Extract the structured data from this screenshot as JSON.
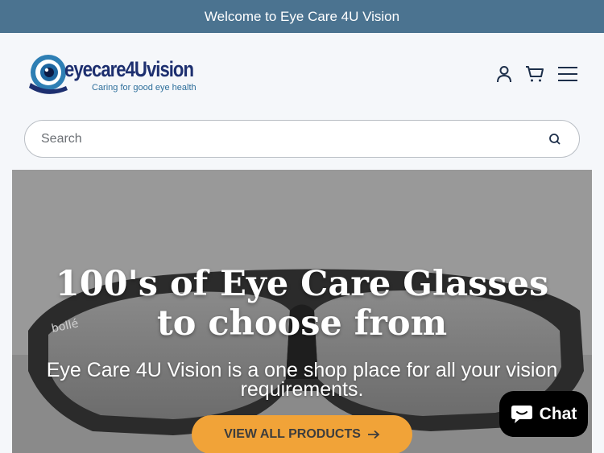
{
  "announcement": {
    "text": "Welcome to Eye Care 4U Vision"
  },
  "brand": {
    "wordmark": "eyecare4Uvision",
    "tagline": "Caring for good eye health"
  },
  "header_icons": [
    {
      "name": "account-icon"
    },
    {
      "name": "cart-icon"
    },
    {
      "name": "menu-icon"
    }
  ],
  "search": {
    "placeholder": "Search",
    "value": ""
  },
  "hero": {
    "title_line1": "100's of Eye Care Glasses",
    "title_line2": "to choose from",
    "subtitle_line1": "Eye Care 4U Vision is a one shop place for all your vision",
    "subtitle_line2": "requirements.",
    "product_brand": "bollé",
    "cta_label": "VIEW ALL PRODUCTS"
  },
  "chat": {
    "label": "Chat"
  },
  "colors": {
    "announce_bg": "#4b7390",
    "brand_navy": "#1d2f6f",
    "brand_blue": "#2e6f9b",
    "cta_bg": "#f1a338"
  }
}
